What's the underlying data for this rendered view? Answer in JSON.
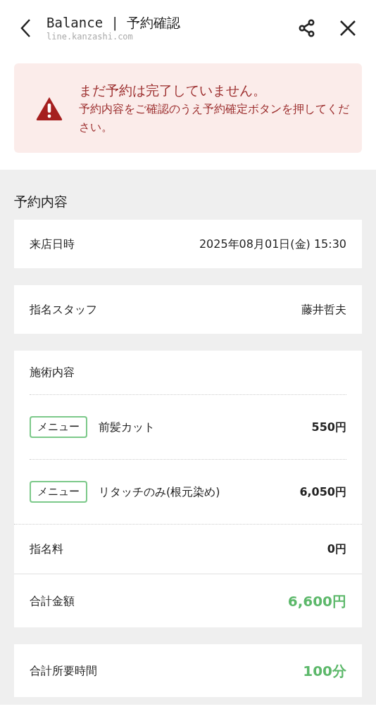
{
  "header": {
    "title": "Balance | 予約確認",
    "url": "line.kanzashi.com"
  },
  "alert": {
    "title": "まだ予約は完了していません。",
    "message": "予約内容をご確認のうえ予約確定ボタンを押してください。"
  },
  "section_title": "予約内容",
  "cards": [
    {
      "kind": "row",
      "label": "来店日時",
      "value": "2025年08月01日(金) 15:30"
    },
    {
      "kind": "row",
      "label": "指名スタッフ",
      "value": "藤井哲夫"
    },
    {
      "kind": "services",
      "label": "施術内容",
      "items": [
        {
          "tag": "メニュー",
          "name": "前髪カット",
          "price": "550円"
        },
        {
          "tag": "メニュー",
          "name": "リタッチのみ(根元染め)",
          "price": "6,050円"
        }
      ],
      "fee": {
        "label": "指名料",
        "value": "0円"
      }
    },
    {
      "kind": "total",
      "label": "合計金額",
      "value": "6,600円"
    },
    {
      "kind": "total",
      "label": "合計所要時間",
      "value": "100分"
    }
  ]
}
